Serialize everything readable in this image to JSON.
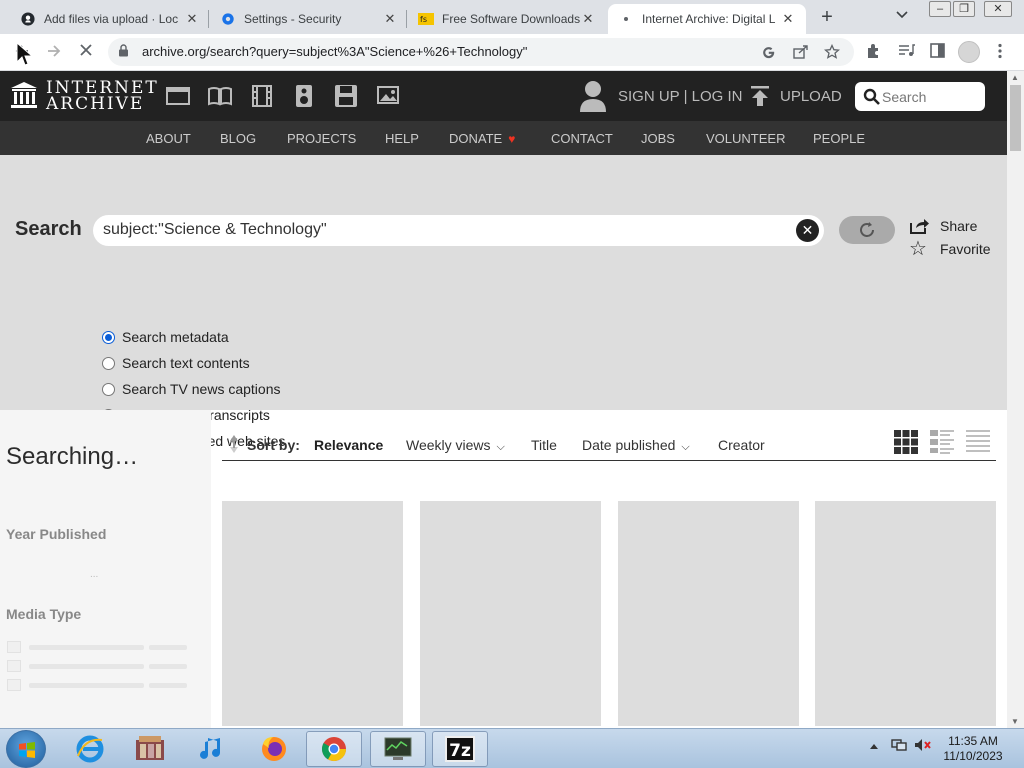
{
  "browser": {
    "tabs": [
      {
        "title": "Add files via upload · Loc",
        "icon": "github-icon"
      },
      {
        "title": "Settings - Security",
        "icon": "gear-icon"
      },
      {
        "title": "Free Software Downloads",
        "icon": "download-site-icon"
      },
      {
        "title": "Internet Archive: Digital L",
        "icon": "loading-dot-icon"
      }
    ],
    "new_tab": "+",
    "url": "archive.org/search?query=subject%3A\"Science+%26+Technology\""
  },
  "ia": {
    "logo_line1": "INTERNET",
    "logo_line2": "ARCHIVE",
    "signin": "SIGN UP | LOG IN",
    "upload": "UPLOAD",
    "search_placeholder": "Search",
    "nav": [
      "ABOUT",
      "BLOG",
      "PROJECTS",
      "HELP",
      "DONATE",
      "CONTACT",
      "JOBS",
      "VOLUNTEER",
      "PEOPLE"
    ],
    "heart_color": "#e32222"
  },
  "search_panel": {
    "label": "Search",
    "query": "subject:\"Science & Technology\"",
    "share": "Share",
    "favorite": "Favorite",
    "options": [
      {
        "label": "Search metadata",
        "checked": true
      },
      {
        "label": "Search text contents",
        "checked": false
      },
      {
        "label": "Search TV news captions",
        "checked": false
      },
      {
        "label": "Search radio transcripts",
        "checked": false
      },
      {
        "label": "Search archived web sites",
        "checked": false
      }
    ]
  },
  "sidebar": {
    "status": "Searching…",
    "year_heading": "Year Published",
    "year_placeholder": "...",
    "media_heading": "Media Type"
  },
  "results": {
    "sort_label": "Sort by:",
    "sort_options": [
      "Relevance",
      "Weekly views",
      "Title",
      "Date published",
      "Creator"
    ],
    "active_sort": "Relevance"
  },
  "taskbar": {
    "clock_time": "11:35 AM",
    "clock_date": "11/10/2023",
    "apps": [
      "internet-explorer-icon",
      "media-center-icon",
      "itunes-icon",
      "firefox-icon",
      "chrome-icon",
      "system-monitor-icon",
      "7zip-icon"
    ],
    "seven_zip_label": "7z"
  }
}
